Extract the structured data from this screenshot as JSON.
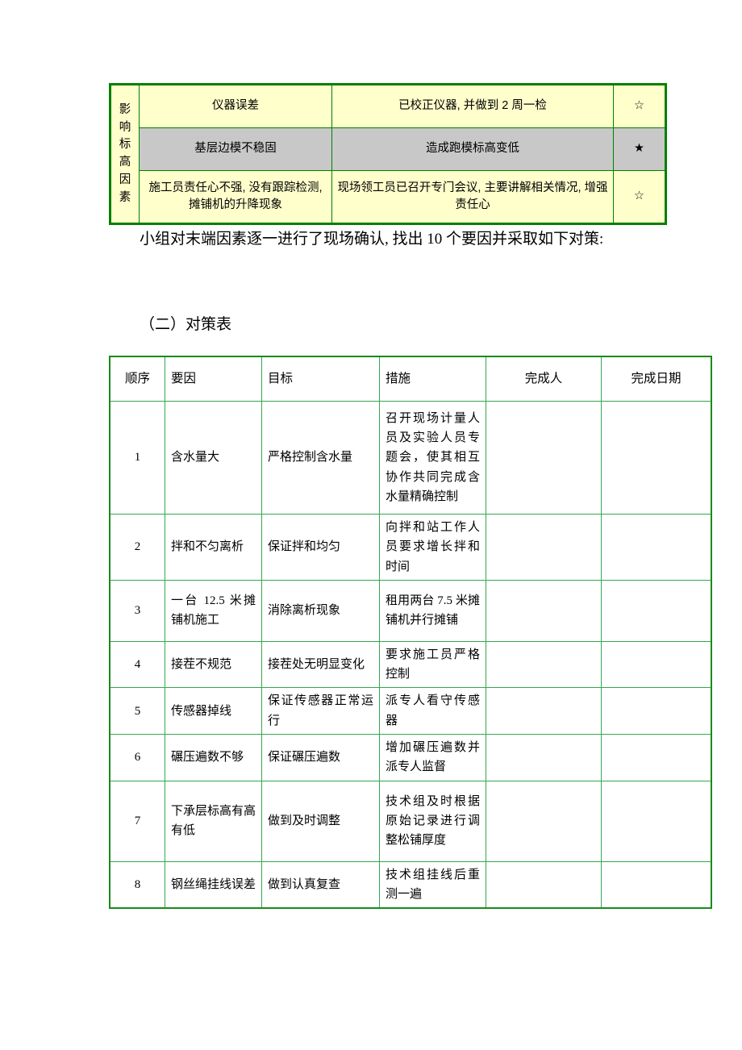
{
  "document": {
    "cause_table": {
      "side_label": "影响标高因素",
      "side_label_chars": [
        "影",
        "响",
        "标",
        "高",
        "因",
        "素"
      ],
      "rows": [
        {
          "factor": "仪器误差",
          "result": "已校正仪器, 并做到 2 周一检",
          "mark": "☆",
          "mark_name": "star-hollow",
          "style": "yellow"
        },
        {
          "factor": "基层边模不稳固",
          "result": "造成跑模标高变低",
          "mark": "★",
          "mark_name": "star-filled",
          "style": "gray"
        },
        {
          "factor": "施工员责任心不强, 没有跟踪检测, 摊铺机的升降现象",
          "result": "现场领工员已召开专门会议, 主要讲解相关情况, 增强责任心",
          "mark": "☆",
          "mark_name": "star-hollow",
          "style": "yellow"
        }
      ],
      "colors": {
        "border": "#008000",
        "yellow_fill": "#ffffcc",
        "gray_fill": "#c8c8c8"
      }
    },
    "paragraphs": [
      "小组对末端因素逐一进行了现场确认, 找出 10 个要因并采取如下对策:",
      "（二）对策表"
    ],
    "measure_table": {
      "headers": [
        "顺序",
        "要因",
        "目标",
        "措施",
        "完成人",
        "完成日期"
      ],
      "rows": [
        {
          "seq": "1",
          "factor": "含水量大",
          "goal": "严格控制含水量",
          "measure": "召开现场计量人员及实验人员专题会，使其相互协作共同完成含水量精确控制",
          "person": "",
          "date": ""
        },
        {
          "seq": "2",
          "factor": "拌和不匀离析",
          "goal": "保证拌和均匀",
          "measure": "向拌和站工作人员要求增长拌和时间",
          "person": "",
          "date": ""
        },
        {
          "seq": "3",
          "factor": "一台 12.5 米摊铺机施工",
          "goal": "消除离析现象",
          "measure": "租用两台 7.5 米摊铺机并行摊铺",
          "person": "",
          "date": ""
        },
        {
          "seq": "4",
          "factor": "接茬不规范",
          "goal": "接茬处无明显变化",
          "measure": "要求施工员严格控制",
          "person": "",
          "date": ""
        },
        {
          "seq": "5",
          "factor": "传感器掉线",
          "goal": "保证传感器正常运行",
          "measure": "派专人看守传感器",
          "person": "",
          "date": ""
        },
        {
          "seq": "6",
          "factor": "碾压遍数不够",
          "goal": "保证碾压遍数",
          "measure": "增加碾压遍数并派专人监督",
          "person": "",
          "date": ""
        },
        {
          "seq": "7",
          "factor": "下承层标高有高有低",
          "goal": "做到及时调整",
          "measure": "技术组及时根据原始记录进行调整松铺厚度",
          "person": "",
          "date": ""
        },
        {
          "seq": "8",
          "factor": "钢丝绳挂线误差",
          "goal": "做到认真复查",
          "measure": "技术组挂线后重测一遍",
          "person": "",
          "date": ""
        }
      ],
      "colors": {
        "border": "#32a852",
        "outer_border": "#1a8a1a"
      }
    }
  }
}
